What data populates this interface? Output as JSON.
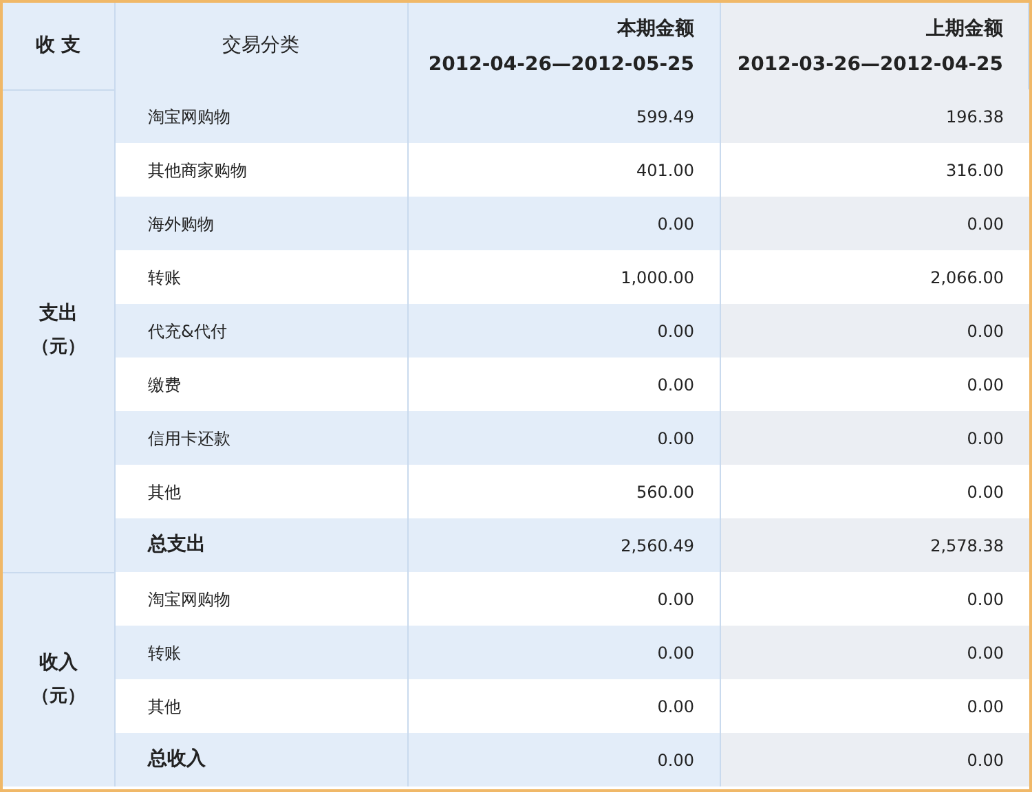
{
  "header": {
    "col_type": "收 支",
    "col_category": "交易分类",
    "current": {
      "title": "本期金额",
      "range": "2012-04-26—2012-05-25"
    },
    "previous": {
      "title": "上期金额",
      "range": "2012-03-26—2012-04-25"
    }
  },
  "groups": [
    {
      "label": "支出",
      "unit": "（元）",
      "rows": [
        {
          "kind": "item",
          "category": "淘宝网购物",
          "current": "599.49",
          "previous": "196.38"
        },
        {
          "kind": "item",
          "category": "其他商家购物",
          "current": "401.00",
          "previous": "316.00"
        },
        {
          "kind": "item",
          "category": "海外购物",
          "current": "0.00",
          "previous": "0.00"
        },
        {
          "kind": "item",
          "category": "转账",
          "current": "1,000.00",
          "previous": "2,066.00"
        },
        {
          "kind": "item",
          "category": "代充&代付",
          "current": "0.00",
          "previous": "0.00"
        },
        {
          "kind": "item",
          "category": "缴费",
          "current": "0.00",
          "previous": "0.00"
        },
        {
          "kind": "item",
          "category": "信用卡还款",
          "current": "0.00",
          "previous": "0.00"
        },
        {
          "kind": "item",
          "category": "其他",
          "current": "560.00",
          "previous": "0.00"
        },
        {
          "kind": "total",
          "category": "总支出",
          "current": "2,560.49",
          "previous": "2,578.38"
        }
      ]
    },
    {
      "label": "收入",
      "unit": "（元）",
      "rows": [
        {
          "kind": "item",
          "category": "淘宝网购物",
          "current": "0.00",
          "previous": "0.00"
        },
        {
          "kind": "item",
          "category": "转账",
          "current": "0.00",
          "previous": "0.00"
        },
        {
          "kind": "item",
          "category": "其他",
          "current": "0.00",
          "previous": "0.00"
        },
        {
          "kind": "total",
          "category": "总收入",
          "current": "0.00",
          "previous": "0.00"
        }
      ]
    }
  ]
}
